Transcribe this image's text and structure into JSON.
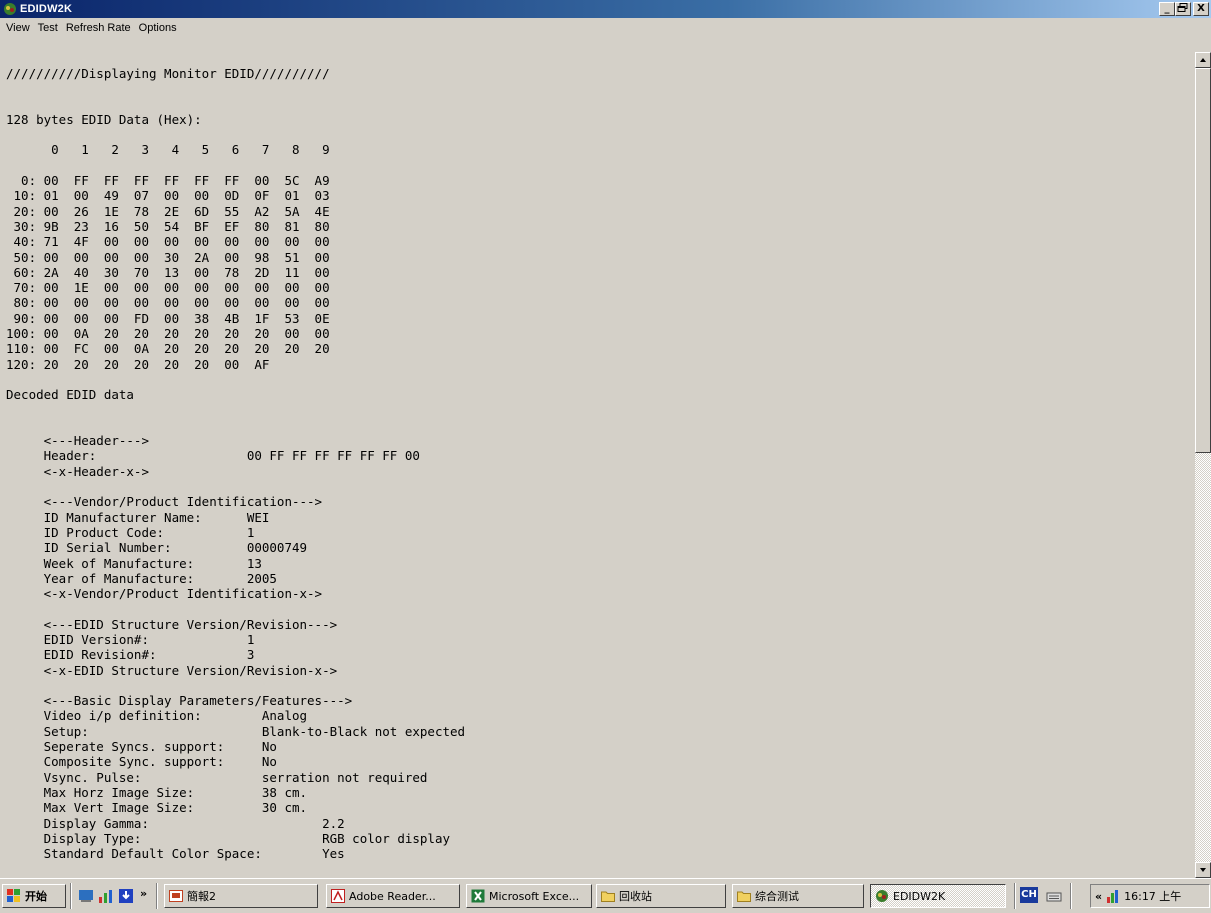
{
  "window": {
    "title": "EDIDW2K",
    "buttons": [
      "_",
      "ᵇ",
      "X"
    ]
  },
  "menu": [
    "View",
    "Test",
    "Refresh Rate",
    "Options"
  ],
  "output_lines": [
    "//////////Displaying Monitor EDID//////////",
    "",
    "",
    "128 bytes EDID Data (Hex):",
    "",
    "      0   1   2   3   4   5   6   7   8   9",
    "",
    "  0: 00  FF  FF  FF  FF  FF  FF  00  5C  A9",
    " 10: 01  00  49  07  00  00  0D  0F  01  03",
    " 20: 00  26  1E  78  2E  6D  55  A2  5A  4E",
    " 30: 9B  23  16  50  54  BF  EF  80  81  80",
    " 40: 71  4F  00  00  00  00  00  00  00  00",
    " 50: 00  00  00  00  30  2A  00  98  51  00",
    " 60: 2A  40  30  70  13  00  78  2D  11  00",
    " 70: 00  1E  00  00  00  00  00  00  00  00",
    " 80: 00  00  00  00  00  00  00  00  00  00",
    " 90: 00  00  00  FD  00  38  4B  1F  53  0E",
    "100: 00  0A  20  20  20  20  20  20  00  00",
    "110: 00  FC  00  0A  20  20  20  20  20  20",
    "120: 20  20  20  20  20  20  00  AF",
    "",
    "Decoded EDID data",
    "",
    "",
    "     <---Header--->",
    "     Header:                    00 FF FF FF FF FF FF 00",
    "     <-x-Header-x->",
    "",
    "     <---Vendor/Product Identification--->",
    "     ID Manufacturer Name:      WEI",
    "     ID Product Code:           1",
    "     ID Serial Number:          00000749",
    "     Week of Manufacture:       13",
    "     Year of Manufacture:       2005",
    "     <-x-Vendor/Product Identification-x->",
    "",
    "     <---EDID Structure Version/Revision--->",
    "     EDID Version#:             1",
    "     EDID Revision#:            3",
    "     <-x-EDID Structure Version/Revision-x->",
    "",
    "     <---Basic Display Parameters/Features--->",
    "     Video i/p definition:        Analog",
    "     Setup:                       Blank-to-Black not expected",
    "     Seperate Syncs. support:     No",
    "     Composite Sync. support:     No",
    "     Vsync. Pulse:                serration not required",
    "     Max Horz Image Size:         38 cm.",
    "     Max Vert Image Size:         30 cm.",
    "     Display Gamma:                       2.2",
    "     Display Type:                        RGB color display",
    "     Standard Default Color Space:        Yes"
  ],
  "taskbar": {
    "start_label": "开始",
    "tasks": [
      {
        "label": "簡報2",
        "icon": "presentation-icon"
      },
      {
        "label": "Adobe Reader...",
        "icon": "adobe-reader-icon"
      },
      {
        "label": "Microsoft Exce...",
        "icon": "excel-icon"
      },
      {
        "label": "回收站",
        "icon": "folder-icon"
      },
      {
        "label": "综合测试",
        "icon": "folder-icon"
      },
      {
        "label": "EDIDW2K",
        "icon": "edidw2k-app-icon"
      }
    ],
    "language": "CH",
    "clock": "16:17 上午"
  }
}
